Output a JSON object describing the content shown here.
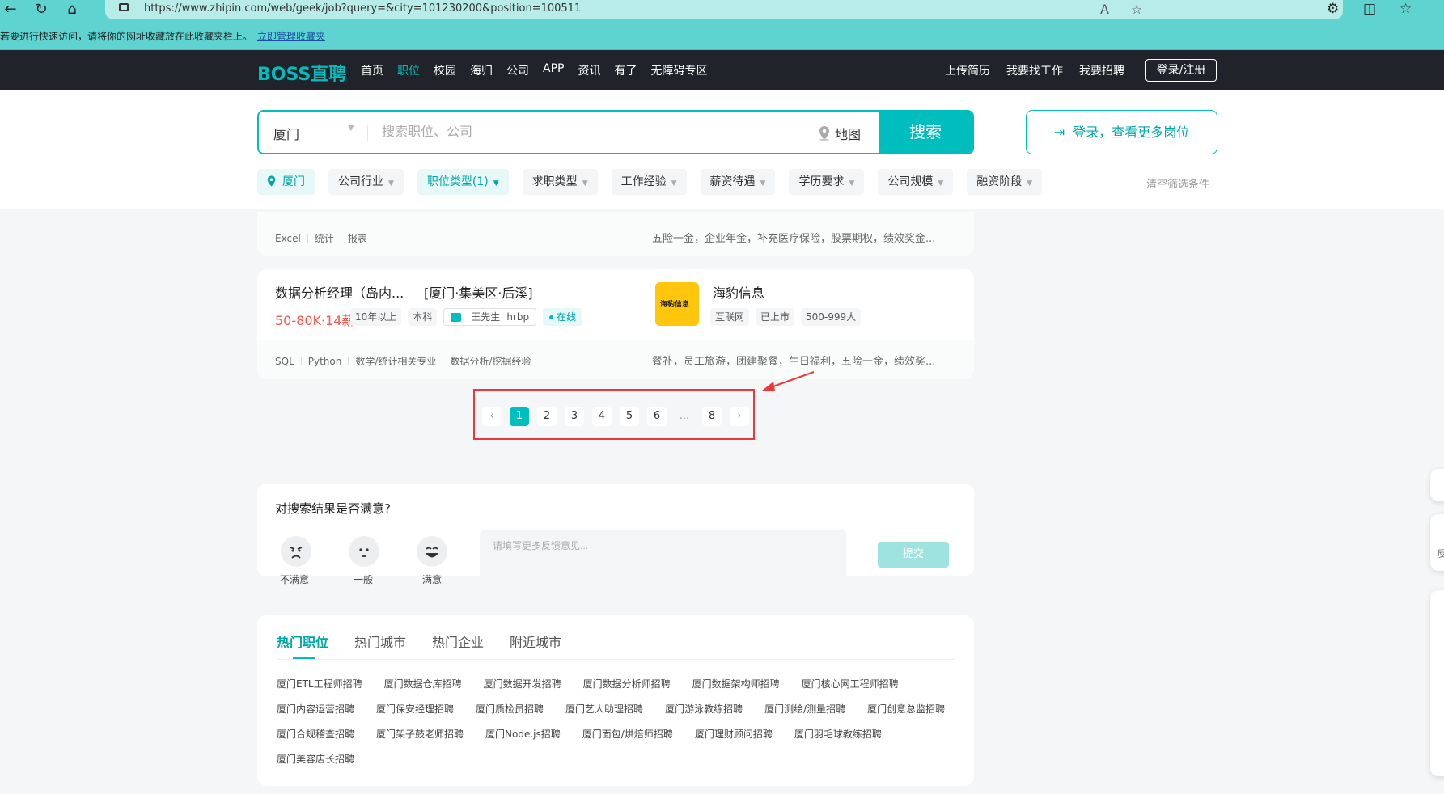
{
  "browser": {
    "url": "https://www.zhipin.com/web/geek/job?query=&city=101230200&position=100511",
    "fav_message": "若要进行快速访问，请将你的网址收藏放在此收藏夹栏上。",
    "fav_link": "立即管理收藏夹"
  },
  "header": {
    "logo": "BOSS直聘",
    "nav": [
      "首页",
      "职位",
      "校园",
      "海归",
      "公司",
      "APP",
      "资讯",
      "有了",
      "无障碍专区"
    ],
    "right_links": [
      "上传简历",
      "我要找工作",
      "我要招聘"
    ],
    "login": "登录/注册"
  },
  "search": {
    "city": "厦门",
    "placeholder": "搜索职位、公司",
    "map": "地图",
    "button": "搜索",
    "login_more": "登录，查看更多岗位"
  },
  "filters": {
    "city": "厦门",
    "items": [
      "公司行业",
      "职位类型(1)",
      "求职类型",
      "工作经验",
      "薪资待遇",
      "学历要求",
      "公司规模",
      "融资阶段"
    ],
    "clear": "清空筛选条件"
  },
  "prev_card": {
    "tags": [
      "Excel",
      "统计",
      "报表"
    ],
    "welfare": "五险一金，企业年金，补充医疗保险，股票期权，绩效奖金..."
  },
  "job": {
    "title": "数据分析经理（岛内...",
    "area": "[厦门·集美区·后溪]",
    "salary": "50-80K·14薪",
    "tags": [
      "10年以上",
      "本科"
    ],
    "recruiter": "王先生",
    "recruiter_role": "hrbp",
    "online": "在线",
    "company_logo_text": "海豹信息",
    "company": "海豹信息",
    "company_tags": [
      "互联网",
      "已上市",
      "500-999人"
    ],
    "skills": [
      "SQL",
      "Python",
      "数学/统计相关专业",
      "数据分析/挖掘经验"
    ],
    "welfare": "餐补，员工旅游，团建聚餐，生日福利，五险一金，绩效奖..."
  },
  "pagination": {
    "prev": "‹",
    "pages": [
      "1",
      "2",
      "3",
      "4",
      "5",
      "6"
    ],
    "ellipsis": "...",
    "last": "8",
    "next": "›",
    "current": "1"
  },
  "feedback": {
    "title": "对搜索结果是否满意?",
    "options": [
      "不满意",
      "一般",
      "满意"
    ],
    "placeholder": "请填写更多反馈意见...",
    "submit": "提交"
  },
  "hot": {
    "tabs": [
      "热门职位",
      "热门城市",
      "热门企业",
      "附近城市"
    ],
    "rows": [
      [
        "厦门ETL工程师招聘",
        "厦门数据仓库招聘",
        "厦门数据开发招聘",
        "厦门数据分析师招聘",
        "厦门数据架构师招聘",
        "厦门核心网工程师招聘"
      ],
      [
        "厦门内容运营招聘",
        "厦门保安经理招聘",
        "厦门质检员招聘",
        "厦门艺人助理招聘",
        "厦门游泳教练招聘",
        "厦门测绘/测量招聘",
        "厦门创意总监招聘"
      ],
      [
        "厦门合规稽查招聘",
        "厦门架子鼓老师招聘",
        "厦门Node.js招聘",
        "厦门面包/烘焙师招聘",
        "厦门理财顾问招聘",
        "厦门羽毛球教练招聘"
      ],
      [
        "厦门美容店长招聘"
      ]
    ]
  },
  "side": {
    "labels": [
      "反"
    ]
  },
  "colors": {
    "accent": "#00bebd",
    "salary": "#fe574a",
    "annotation": "#e83a3a",
    "header_bg": "#202329"
  }
}
